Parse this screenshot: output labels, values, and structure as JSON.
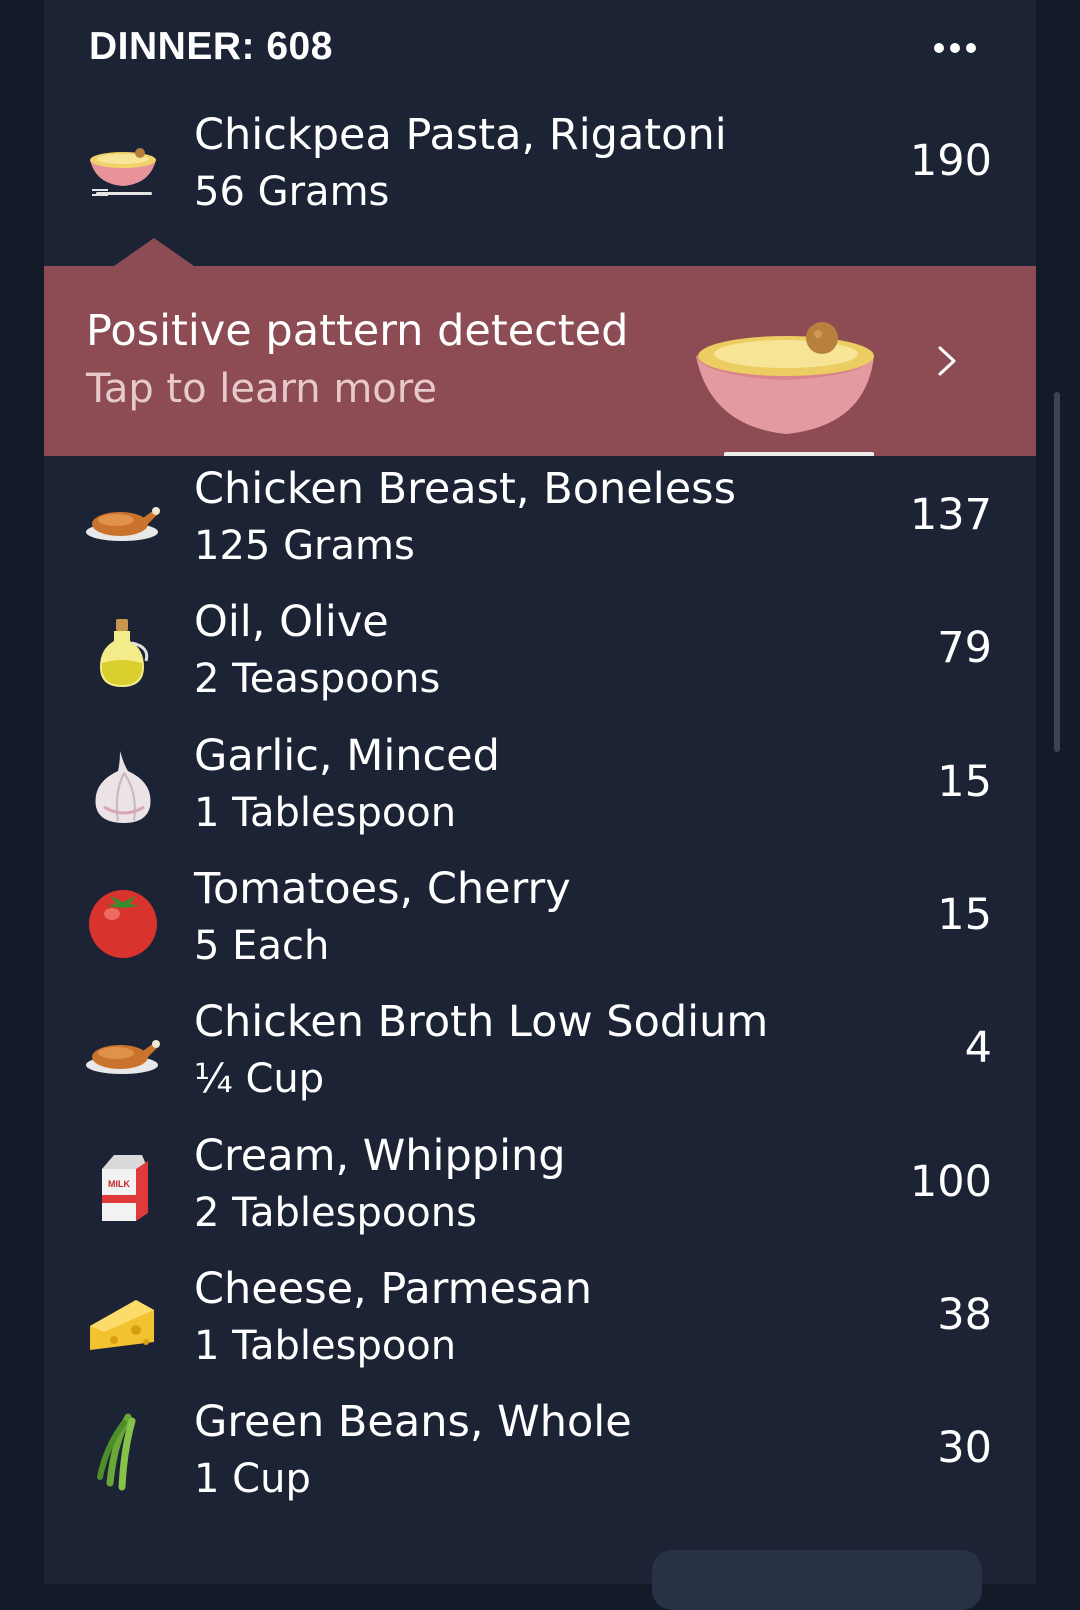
{
  "meal": {
    "title": "DINNER: 608",
    "more_icon": "more-horizontal-icon"
  },
  "banner": {
    "title": "Positive pattern detected",
    "subtitle": "Tap to learn more",
    "image_icon": "pasta-bowl-icon",
    "chevron_icon": "chevron-right-icon",
    "bg_color": "#8d4c53"
  },
  "items": [
    {
      "name": "Chickpea Pasta, Rigatoni",
      "qty": "56 Grams",
      "cal": "190",
      "icon": "pasta-bowl-icon"
    },
    {
      "name": "Chicken Breast, Boneless",
      "qty": "125 Grams",
      "cal": "137",
      "icon": "roast-chicken-icon"
    },
    {
      "name": "Oil, Olive",
      "qty": "2 Teaspoons",
      "cal": "79",
      "icon": "oil-bottle-icon"
    },
    {
      "name": "Garlic, Minced",
      "qty": "1 Tablespoon",
      "cal": "15",
      "icon": "garlic-icon"
    },
    {
      "name": "Tomatoes, Cherry",
      "qty": "5 Each",
      "cal": "15",
      "icon": "tomato-icon"
    },
    {
      "name": "Chicken Broth Low Sodium",
      "qty": "¼ Cup",
      "cal": "4",
      "icon": "roast-chicken-icon"
    },
    {
      "name": "Cream, Whipping",
      "qty": "2 Tablespoons",
      "cal": "100",
      "icon": "milk-carton-icon",
      "icon_text": "MILK"
    },
    {
      "name": "Cheese, Parmesan",
      "qty": "1 Tablespoon",
      "cal": "38",
      "icon": "cheese-icon"
    },
    {
      "name": "Green Beans, Whole",
      "qty": "1 Cup",
      "cal": "30",
      "icon": "green-beans-icon"
    }
  ],
  "colors": {
    "background": "#141b28",
    "card": "#1b2335",
    "text": "#ffffff"
  }
}
